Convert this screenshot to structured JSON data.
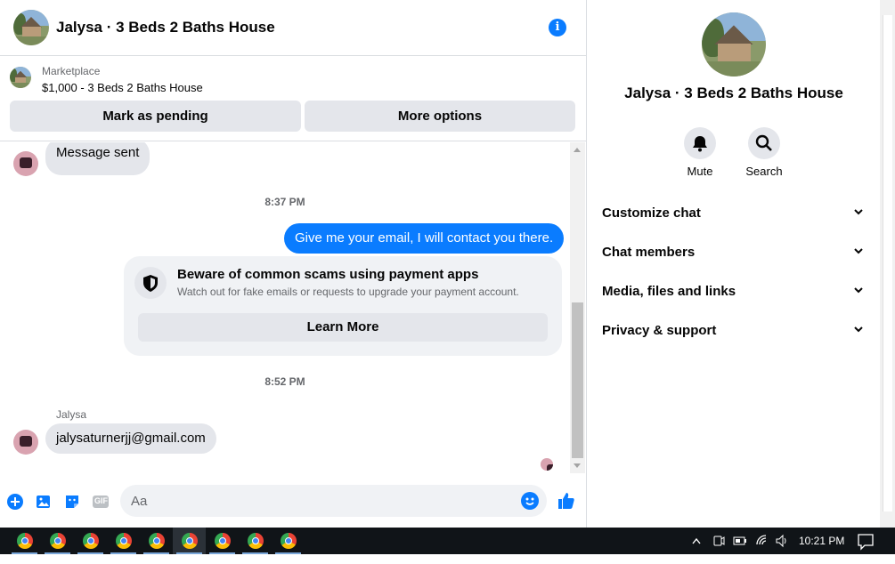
{
  "header": {
    "title": "Jalysa · 3 Beds 2 Baths House"
  },
  "marketplace": {
    "label": "Marketplace",
    "item": "$1,000 - 3 Beds 2 Baths House",
    "mark_pending": "Mark as pending",
    "more_options": "More options"
  },
  "messages": {
    "first": "Message sent",
    "time1": "8:37 PM",
    "outgoing": "Give me your email, I will contact you there.",
    "scam": {
      "title": "Beware of common scams using payment apps",
      "subtitle": "Watch out for fake emails or requests to upgrade your payment account.",
      "button": "Learn More"
    },
    "time2": "8:52 PM",
    "sender": "Jalysa",
    "reply": "jalysaturnerjj@gmail.com"
  },
  "composer": {
    "placeholder": "Aa",
    "gif": "GIF"
  },
  "side": {
    "title": "Jalysa · 3 Beds 2 Baths House",
    "mute": "Mute",
    "search": "Search",
    "rows": [
      "Customize chat",
      "Chat members",
      "Media, files and links",
      "Privacy & support"
    ]
  },
  "taskbar": {
    "time": "10:21 PM"
  },
  "colors": {
    "accent": "#0a7cff",
    "bubble_grey": "#e4e6eb",
    "taskbar": "#101418"
  }
}
